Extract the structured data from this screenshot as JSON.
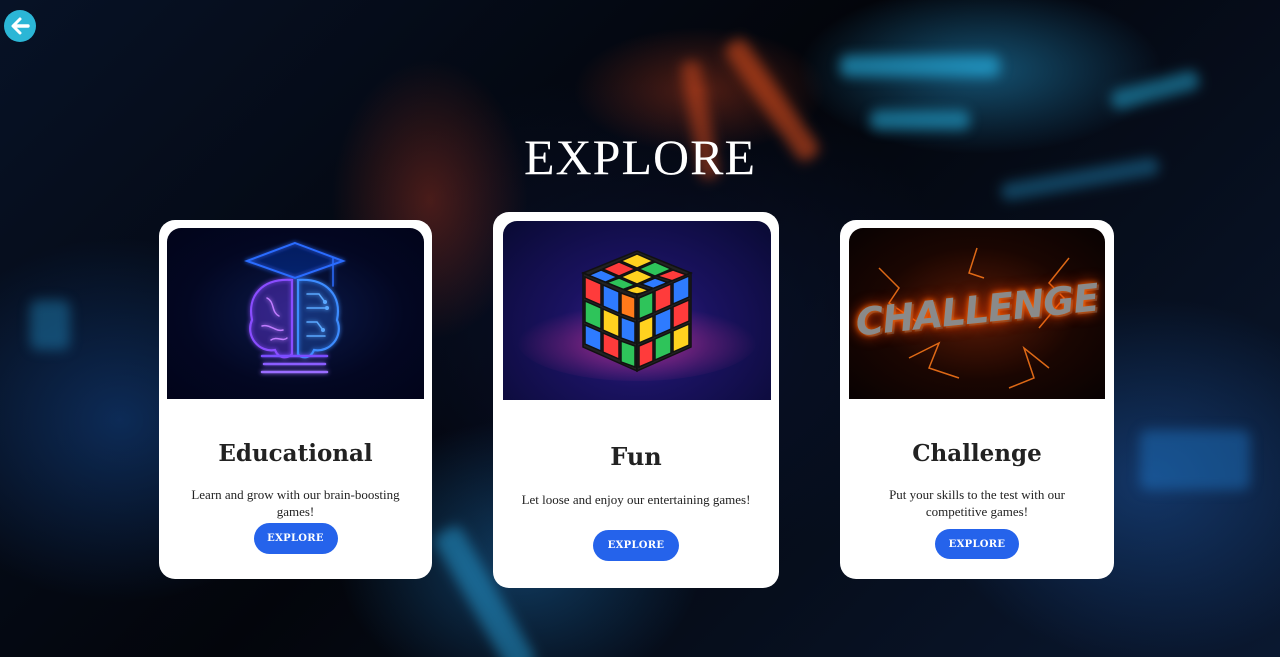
{
  "header": {
    "title": "EXPLORE",
    "back_icon": "arrow-left-icon"
  },
  "cards": [
    {
      "name": "Educational",
      "description": "Learn and grow with our brain-boosting games!",
      "button": "EXPLORE",
      "image_icon": "brain-graduation-cap-icon"
    },
    {
      "name": "Fun",
      "description": "Let loose and enjoy our entertaining games!",
      "button": "EXPLORE",
      "image_icon": "rubiks-cube-icon"
    },
    {
      "name": "Challenge",
      "description": "Put your skills to the test with our competitive games!",
      "button": "EXPLORE",
      "image_text": "CHALLENGE"
    }
  ],
  "colors": {
    "accent": "#2563eb",
    "back_button": "#2bb6d6",
    "card_bg": "#ffffff",
    "title": "#ffffff"
  }
}
